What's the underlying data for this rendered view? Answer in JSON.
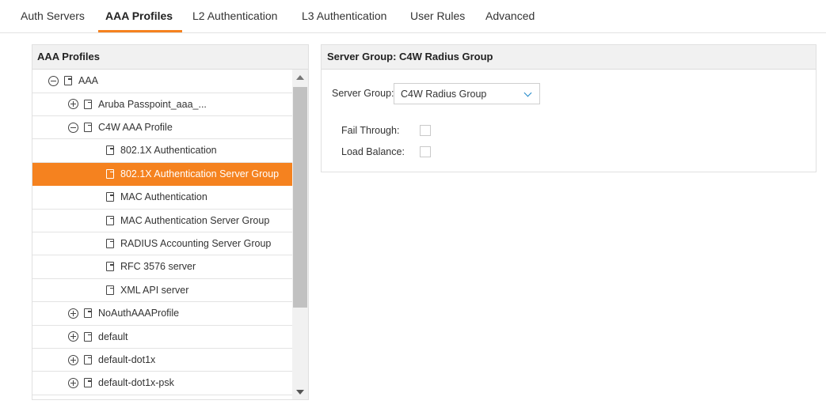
{
  "tabs": [
    {
      "label": "Auth Servers",
      "active": false
    },
    {
      "label": "AAA Profiles",
      "active": true
    },
    {
      "label": "L2 Authentication",
      "active": false
    },
    {
      "label": "L3 Authentication",
      "active": false
    },
    {
      "label": "User Rules",
      "active": false
    },
    {
      "label": "Advanced",
      "active": false
    }
  ],
  "left_panel": {
    "title": "AAA Profiles",
    "tree": [
      {
        "label": "AAA",
        "level": 0,
        "expander": "minus",
        "selected": false
      },
      {
        "label": "Aruba Passpoint_aaa_...",
        "level": 1,
        "expander": "plus",
        "selected": false
      },
      {
        "label": "C4W AAA Profile",
        "level": 1,
        "expander": "minus",
        "selected": false
      },
      {
        "label": "802.1X Authentication",
        "level": 2,
        "expander": "none",
        "selected": false
      },
      {
        "label": "802.1X Authentication Server Group",
        "level": 2,
        "expander": "none",
        "selected": true
      },
      {
        "label": "MAC Authentication",
        "level": 2,
        "expander": "none",
        "selected": false
      },
      {
        "label": "MAC Authentication Server Group",
        "level": 2,
        "expander": "none",
        "selected": false
      },
      {
        "label": "RADIUS Accounting Server Group",
        "level": 2,
        "expander": "none",
        "selected": false
      },
      {
        "label": "RFC 3576 server",
        "level": 2,
        "expander": "none",
        "selected": false
      },
      {
        "label": "XML API server",
        "level": 2,
        "expander": "none",
        "selected": false
      },
      {
        "label": "NoAuthAAAProfile",
        "level": 1,
        "expander": "plus",
        "selected": false
      },
      {
        "label": "default",
        "level": 1,
        "expander": "plus",
        "selected": false
      },
      {
        "label": "default-dot1x",
        "level": 1,
        "expander": "plus",
        "selected": false
      },
      {
        "label": "default-dot1x-psk",
        "level": 1,
        "expander": "plus",
        "selected": false
      }
    ]
  },
  "right_panel": {
    "title": "Server Group: C4W Radius Group",
    "server_group_label": "Server Group:",
    "server_group_value": "C4W Radius Group",
    "fail_through_label": "Fail Through:",
    "fail_through_checked": false,
    "load_balance_label": "Load Balance:",
    "load_balance_checked": false
  },
  "colors": {
    "accent": "#f5821f",
    "chevron": "#1e87c8"
  }
}
